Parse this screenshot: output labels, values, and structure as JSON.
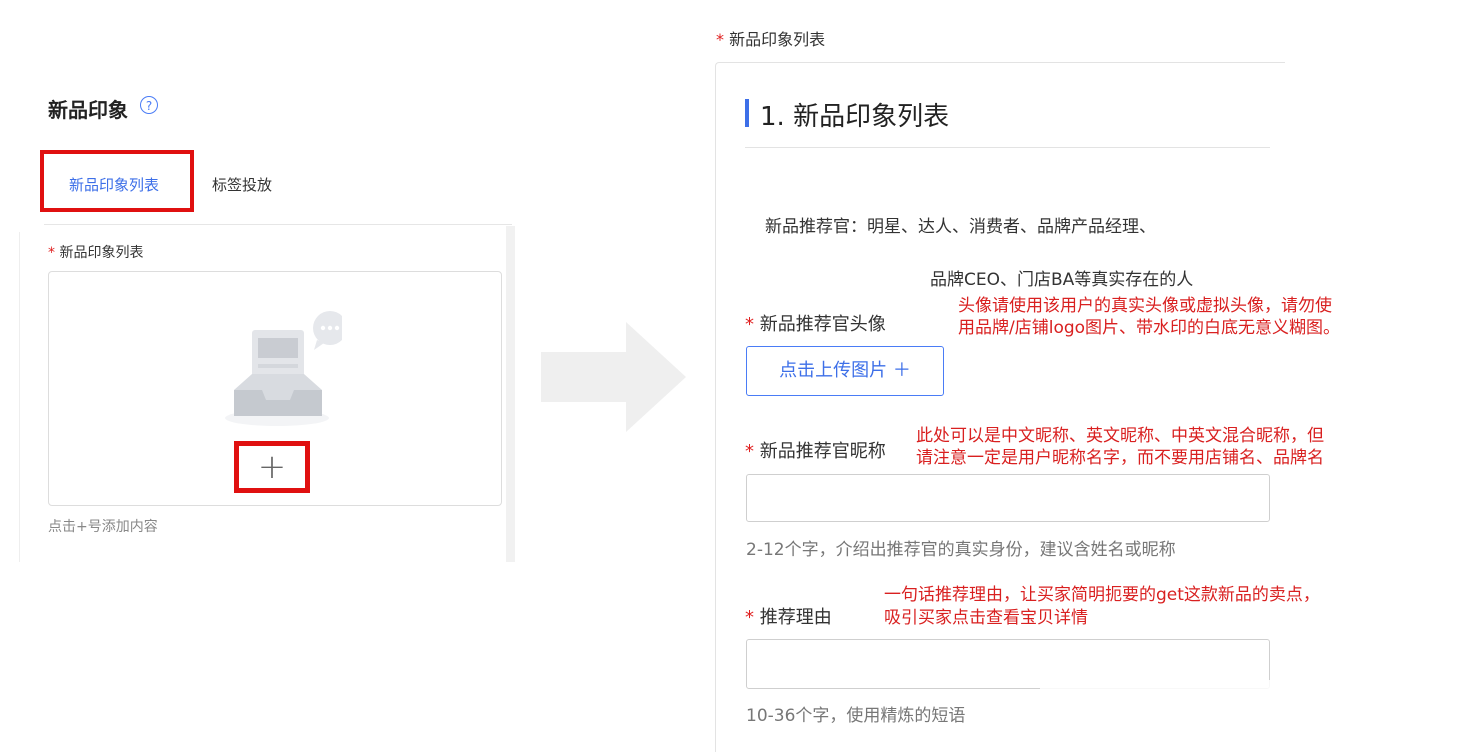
{
  "left": {
    "title": "新品印象",
    "help_icon": "?",
    "tabs": [
      {
        "label": "新品印象列表",
        "active": true
      },
      {
        "label": "标签投放",
        "active": false
      }
    ],
    "field_required_mark": "*",
    "field_label": "新品印象列表",
    "add_button": "+",
    "hint": "点击+号添加内容"
  },
  "right": {
    "top_label": "新品印象列表",
    "section_title": "1. 新品印象列表",
    "description_line1": "新品推荐官：明星、达人、消费者、品牌产品经理、",
    "description_line2": "品牌CEO、门店BA等真实存在的人",
    "avatar_label": "新品推荐官头像",
    "avatar_note_line1": "头像请使用该用户的真实头像或虚拟头像，请勿使",
    "avatar_note_line2": "用品牌/店铺logo图片、带水印的白底无意义糊图。",
    "upload_button": "点击上传图片 ＋",
    "nickname_label": "新品推荐官昵称",
    "nickname_note_line1": "此处可以是中文昵称、英文昵称、中英文混合昵称，但",
    "nickname_note_line2": "请注意一定是用户昵称名字，而不要用店铺名、品牌名",
    "nickname_value": "",
    "nickname_hint": "2-12个字，介绍出推荐官的真实身份，建议含姓名或昵称",
    "reason_label": "推荐理由",
    "reason_note_line1": "一句话推荐理由，让买家简明扼要的get这款新品的卖点，",
    "reason_note_line2": "吸引买家点击查看宝贝详情",
    "reason_value": "",
    "reason_hint": "10-36个字，使用精炼的短语"
  },
  "colors": {
    "accent_blue": "#3d6fe8",
    "annotation_red": "#e01010",
    "required_red": "#e02020",
    "arrow_gray": "#efefef"
  }
}
